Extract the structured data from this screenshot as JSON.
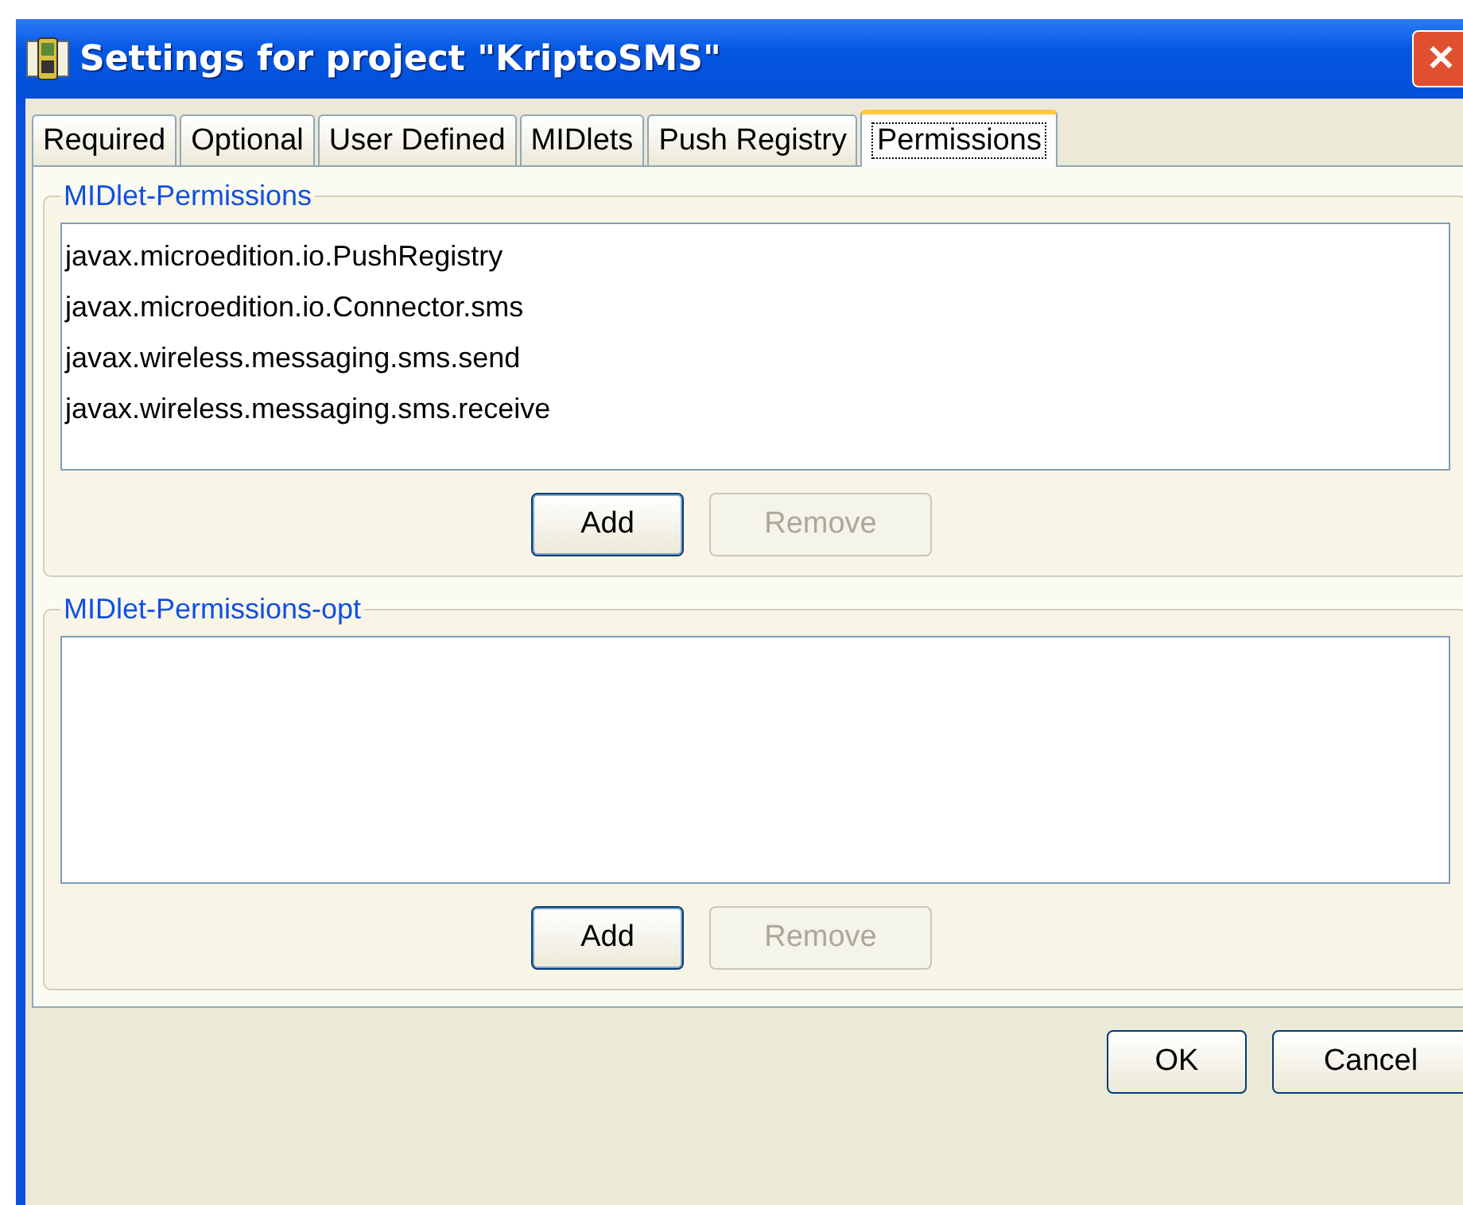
{
  "window": {
    "title": "Settings for project \"KriptoSMS\"",
    "close": "✕"
  },
  "tabs": [
    {
      "label": "Required",
      "selected": false
    },
    {
      "label": "Optional",
      "selected": false
    },
    {
      "label": "User Defined",
      "selected": false
    },
    {
      "label": "MIDlets",
      "selected": false
    },
    {
      "label": "Push Registry",
      "selected": false
    },
    {
      "label": "Permissions",
      "selected": true
    }
  ],
  "groups": [
    {
      "legend": "MIDlet-Permissions",
      "items": [
        "javax.microedition.io.PushRegistry",
        "javax.microedition.io.Connector.sms",
        "javax.wireless.messaging.sms.send",
        "javax.wireless.messaging.sms.receive"
      ],
      "buttons": [
        {
          "label": "Add",
          "disabled": false
        },
        {
          "label": "Remove",
          "disabled": true
        }
      ]
    },
    {
      "legend": "MIDlet-Permissions-opt",
      "buttons": [
        {
          "label": "Add",
          "disabled": false
        },
        {
          "label": "Remove",
          "disabled": true
        }
      ]
    }
  ],
  "buttons": [
    "OK",
    "Cancel"
  ]
}
